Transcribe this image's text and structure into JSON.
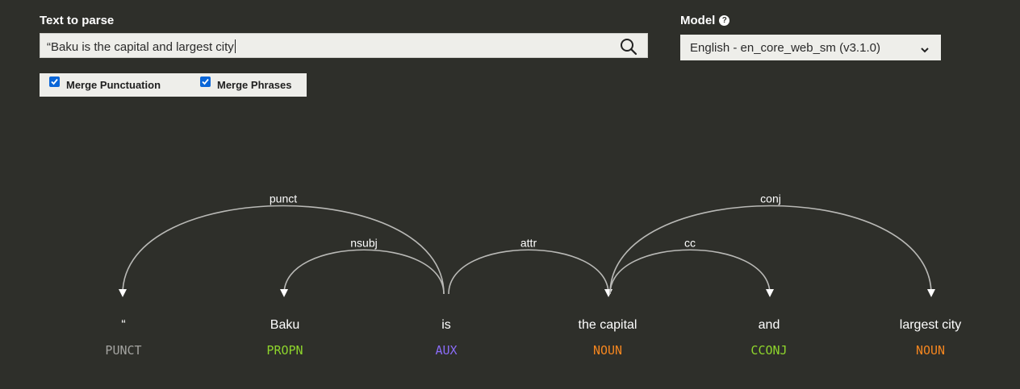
{
  "text_to_parse": {
    "label": "Text to parse",
    "value": "“Baku is the capital and largest city"
  },
  "model": {
    "label": "Model",
    "help_icon": "?",
    "selected": "English - en_core_web_sm (v3.1.0)"
  },
  "options": [
    {
      "label": "Merge Punctuation",
      "checked": true
    },
    {
      "label": "Merge Phrases",
      "checked": true
    }
  ],
  "parse": {
    "tokens": [
      {
        "word": "“",
        "tag": "PUNCT",
        "color": "#a3a3a0"
      },
      {
        "word": "Baku",
        "tag": "PROPN",
        "color": "#8ed52c"
      },
      {
        "word": "is",
        "tag": "AUX",
        "color": "#8a6cf7"
      },
      {
        "word": "the capital",
        "tag": "NOUN",
        "color": "#f5861f"
      },
      {
        "word": "and",
        "tag": "CCONJ",
        "color": "#8ed52c"
      },
      {
        "word": "largest city",
        "tag": "NOUN",
        "color": "#f5861f"
      }
    ],
    "arcs": [
      {
        "label": "punct",
        "head": 2,
        "dep": 0
      },
      {
        "label": "nsubj",
        "head": 2,
        "dep": 1
      },
      {
        "label": "attr",
        "head": 2,
        "dep": 3
      },
      {
        "label": "cc",
        "head": 3,
        "dep": 4
      },
      {
        "label": "conj",
        "head": 3,
        "dep": 5
      }
    ]
  }
}
